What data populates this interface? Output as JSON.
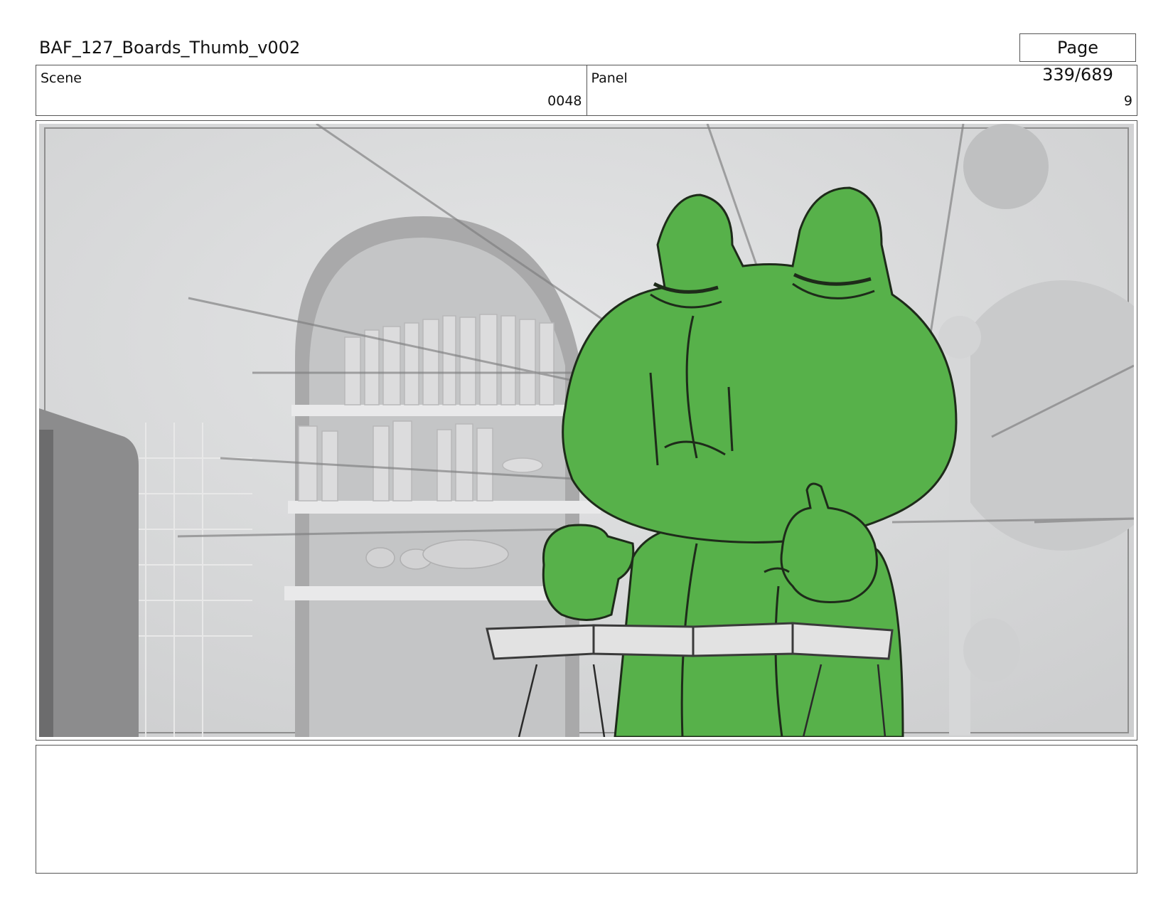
{
  "header": {
    "document_title": "BAF_127_Boards_Thumb_v002",
    "page_indicator": "Page 339/689"
  },
  "info": {
    "scene_label": "Scene",
    "scene_value": "0048",
    "panel_label": "Panel",
    "panel_value": "9"
  },
  "artwork": {
    "description_icon": "storyboard-frog-drawing",
    "character_color": "#57b14a",
    "background_tone": "#d9dadb"
  },
  "notes": {
    "text": ""
  }
}
